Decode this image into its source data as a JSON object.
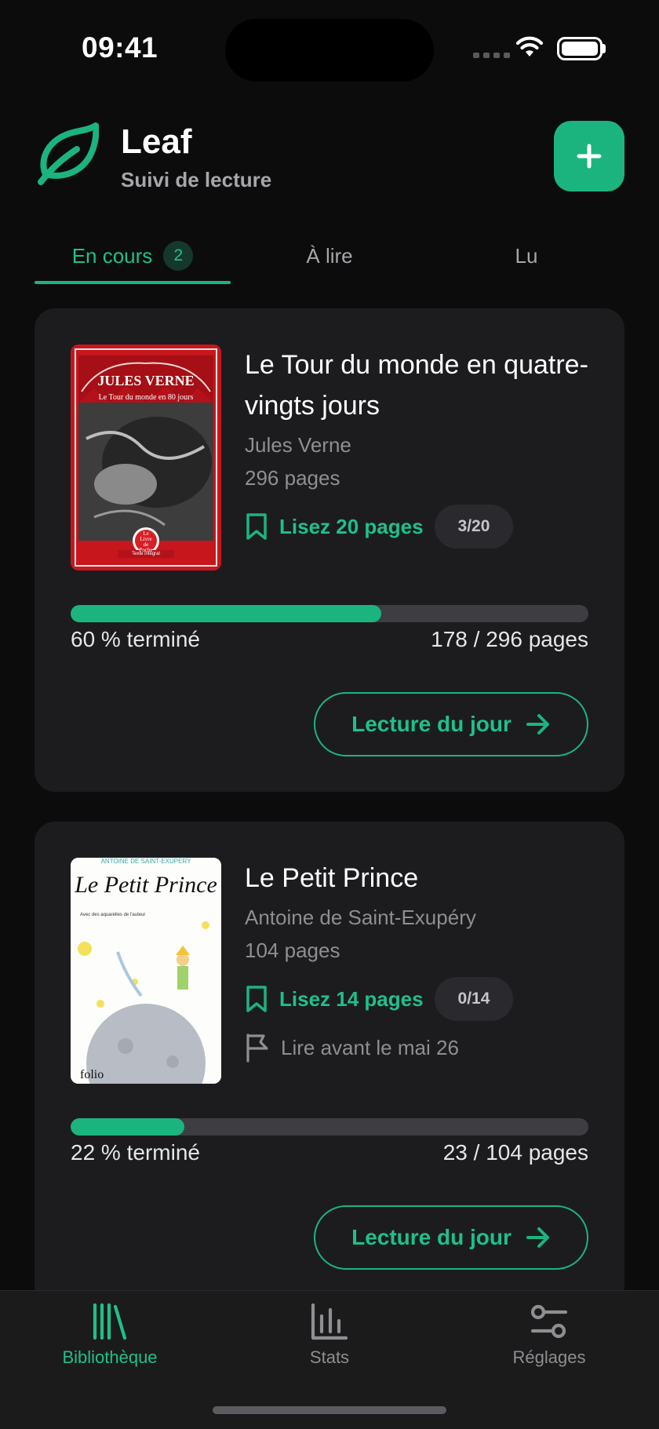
{
  "status_bar": {
    "time": "09:41"
  },
  "header": {
    "title": "Leaf",
    "subtitle": "Suivi de lecture",
    "add_icon": "plus-icon",
    "accent": "#1cb47e"
  },
  "tabs": [
    {
      "label": "En cours",
      "badge": "2",
      "active": true
    },
    {
      "label": "À lire",
      "active": false
    },
    {
      "label": "Lu",
      "active": false
    }
  ],
  "books": [
    {
      "title": "Le Tour du monde en quatre-vingts jours",
      "author": "Jules Verne",
      "pages": "296 pages",
      "goal": "Lisez 20 pages",
      "goal_progress": "3/20",
      "progress_percent": 60,
      "progress_label": "60 % terminé",
      "progress_count": "178 / 296 pages",
      "cta": "Lecture du jour",
      "cover": {
        "author": "JULES VERNE",
        "title": "Le Tour du monde en 80 jours",
        "publisher_line1": "Le",
        "publisher_line2": "Livre",
        "publisher_line3": "de",
        "publisher_line4": "Poche",
        "edition": "Texte intégral"
      }
    },
    {
      "title": "Le Petit Prince",
      "author": "Antoine de Saint-Exupéry",
      "pages": "104 pages",
      "goal": "Lisez 14 pages",
      "goal_progress": "0/14",
      "deadline": "Lire avant le mai 26",
      "progress_percent": 22,
      "progress_label": "22 % terminé",
      "progress_count": "23 / 104 pages",
      "cta": "Lecture du jour",
      "cover": {
        "author": "ANTOINE DE SAINT-EXUPERY",
        "title": "Le Petit Prince",
        "subtitle": "Avec des aquarelles de l'auteur",
        "publisher": "folio"
      }
    }
  ],
  "bottom_nav": [
    {
      "label": "Bibliothèque",
      "icon": "library-icon",
      "active": true
    },
    {
      "label": "Stats",
      "icon": "bar-chart-icon",
      "active": false
    },
    {
      "label": "Réglages",
      "icon": "sliders-icon",
      "active": false
    }
  ]
}
